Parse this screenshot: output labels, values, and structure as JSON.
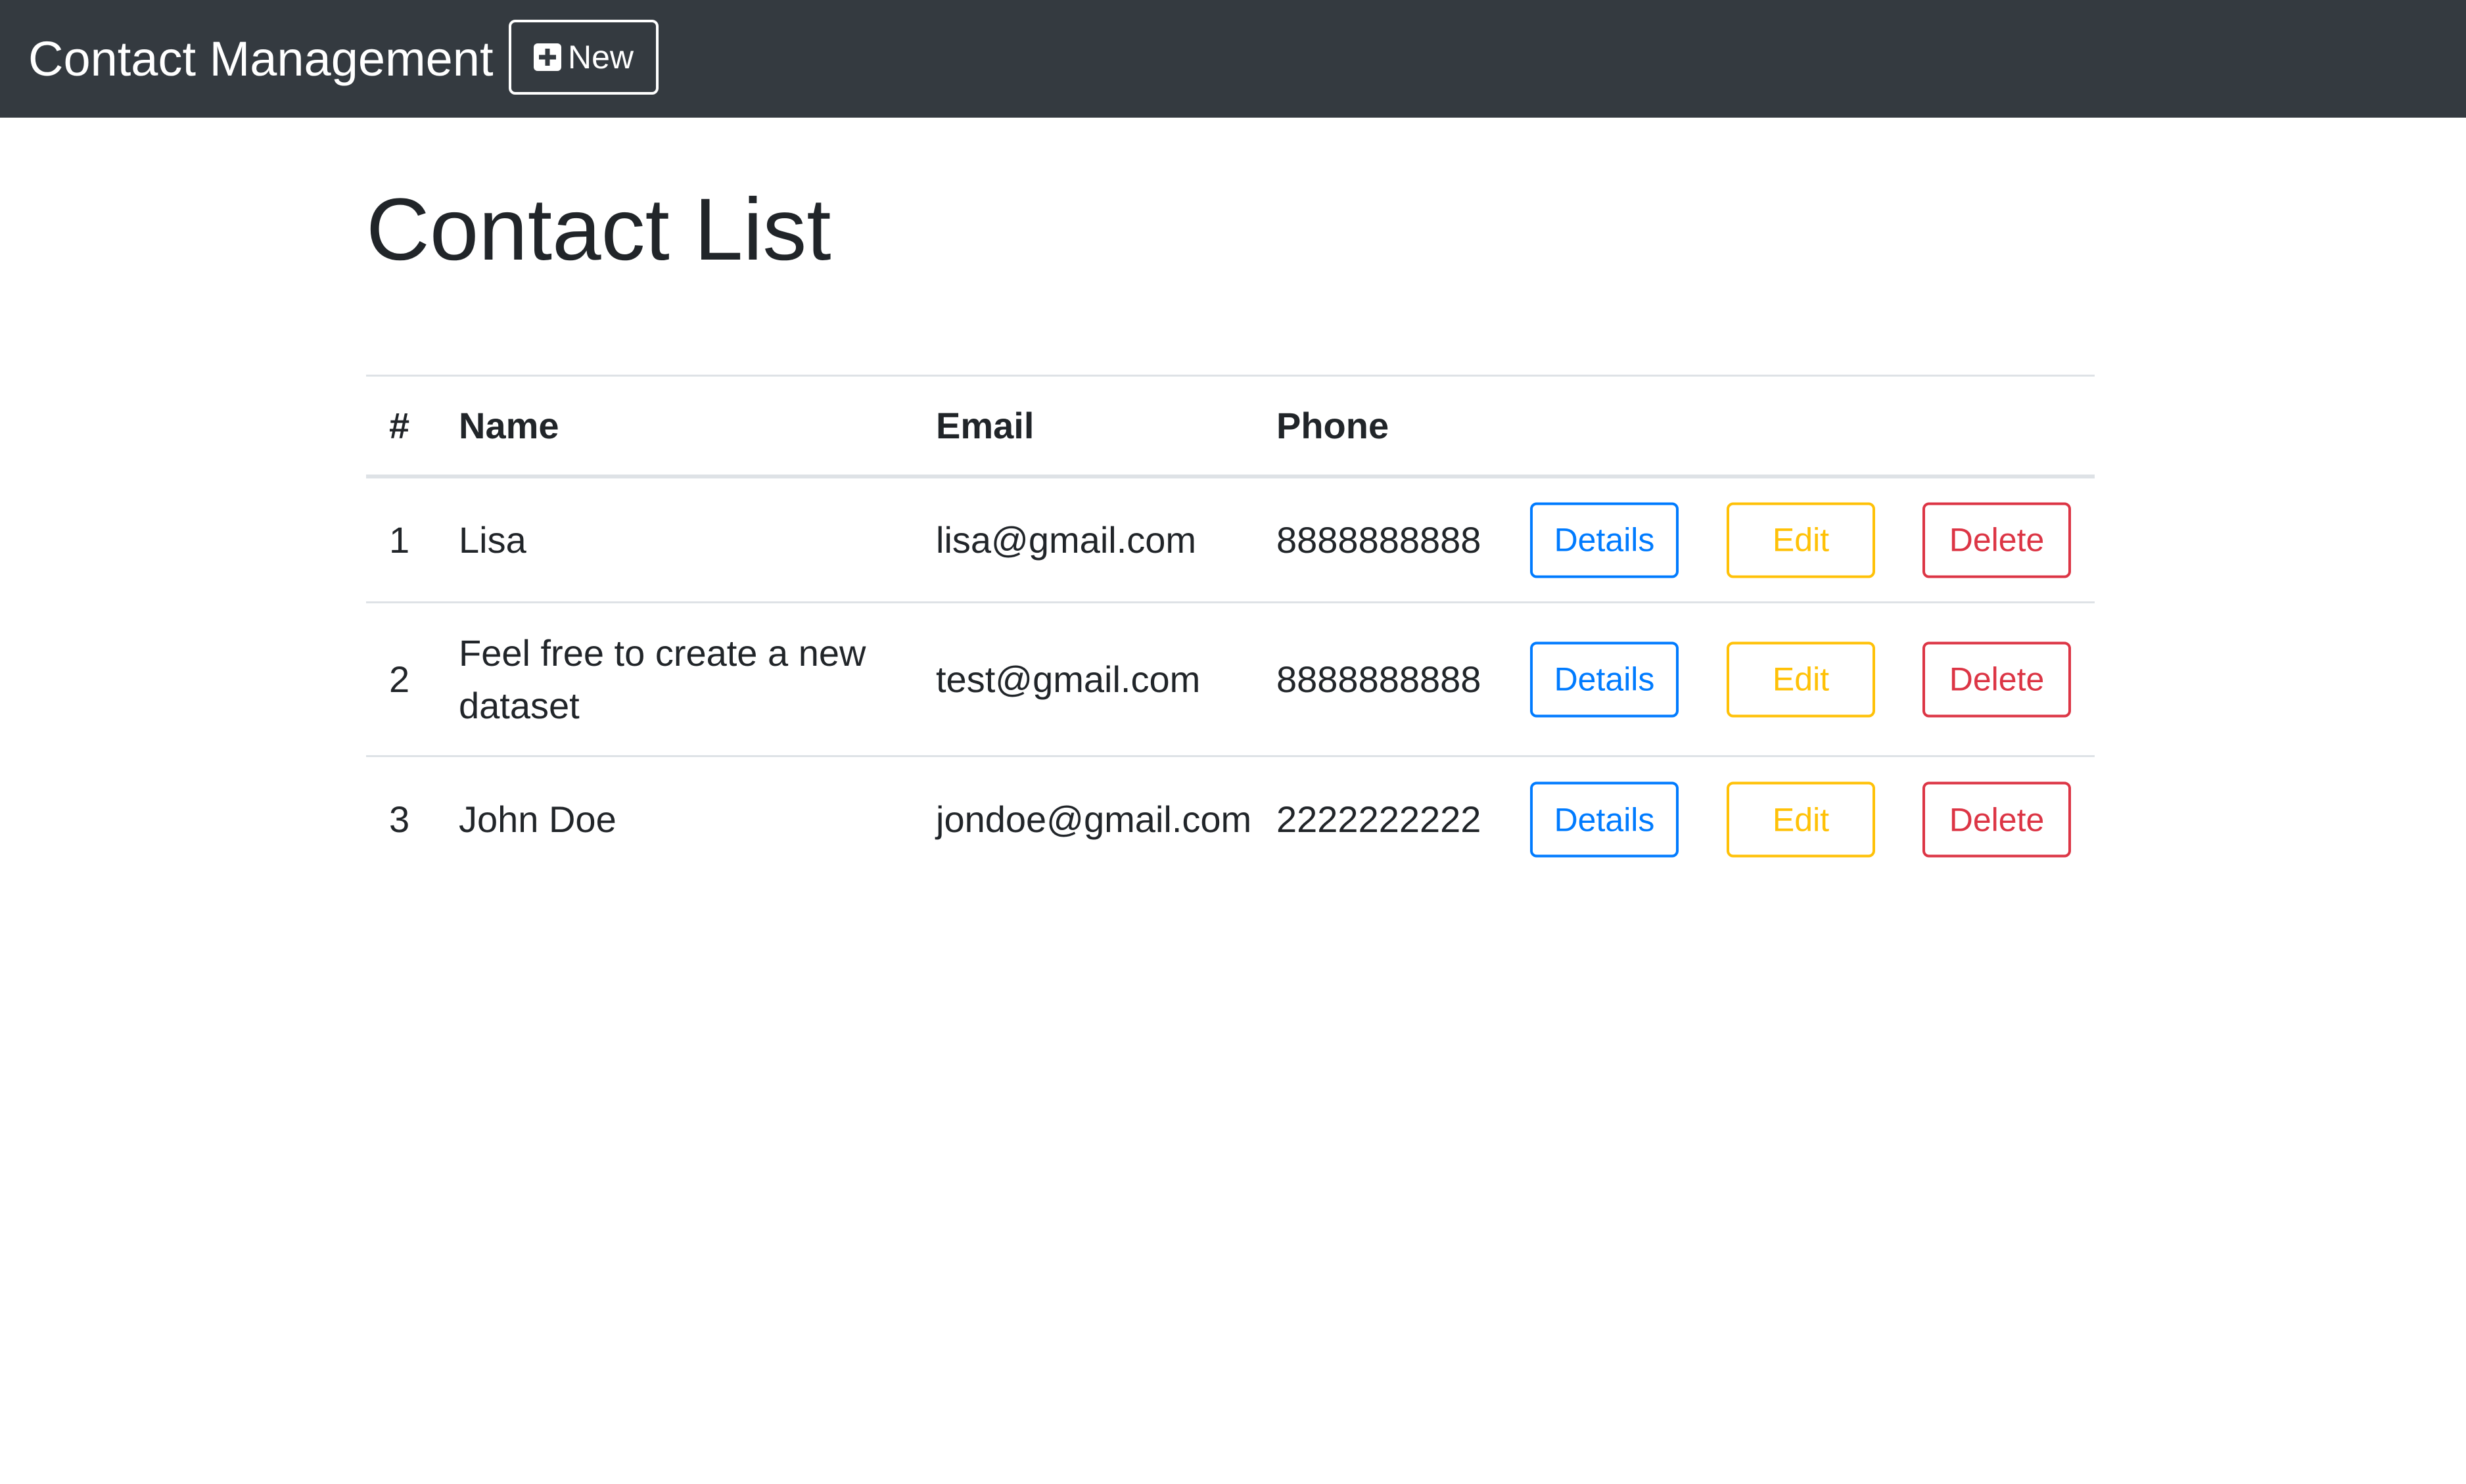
{
  "navbar": {
    "brand": "Contact Management",
    "new_button_label": "New",
    "new_button_icon": "plus-square-icon"
  },
  "page": {
    "title": "Contact List"
  },
  "table": {
    "headers": {
      "num": "#",
      "name": "Name",
      "email": "Email",
      "phone": "Phone"
    },
    "rows": [
      {
        "num": "1",
        "name": "Lisa",
        "email": "lisa@gmail.com",
        "phone": "8888888888"
      },
      {
        "num": "2",
        "name": "Feel free to create a new dataset",
        "email": "test@gmail.com",
        "phone": "8888888888"
      },
      {
        "num": "3",
        "name": "John Doe",
        "email": "jondoe@gmail.com",
        "phone": "2222222222"
      }
    ],
    "actions": {
      "details": "Details",
      "edit": "Edit",
      "delete": "Delete"
    }
  },
  "colors": {
    "navbar_bg": "#343a40",
    "primary": "#007bff",
    "warning": "#ffc107",
    "danger": "#dc3545",
    "text": "#212529",
    "border": "#dee2e6"
  }
}
